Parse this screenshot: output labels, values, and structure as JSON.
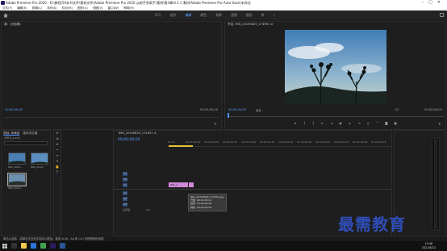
{
  "window": {
    "title": "Adobe Premiere Pro 2020 - D:\\教程\\50本书文件\\素材文件\\Adobe Premiere Pro 2020 从新手到高手\\素材\\第4章\\4.1.1 素材\\Adobe Premiere Pro Auto-Save\\未命名"
  },
  "menu": [
    "文件(F)",
    "编辑(E)",
    "剪辑(C)",
    "序列(S)",
    "标记(M)",
    "图形(G)",
    "视图(V)",
    "窗口(W)",
    "帮助(H)"
  ],
  "workspace_tabs": [
    "学习",
    "组件",
    "编辑",
    "颜色",
    "效果",
    "音频",
    "图形",
    "库",
    "»"
  ],
  "workspace_active": 2,
  "source": {
    "title": "源：(无剪辑)",
    "timecode": "00;00;00;00",
    "timecode_right": "00;00;00;00"
  },
  "program": {
    "title": "节目: IMG_20190829_174951 ≡",
    "timecode": "00;00;00;00",
    "fit": "适合",
    "ratio": "1/2",
    "duration": "00;00;05;00"
  },
  "project": {
    "tabs": [
      "项目: 未命名",
      "媒体浏览器"
    ],
    "path": "未命名.prproj",
    "items": [
      {
        "label": "IMG_2019...",
        "dur": "5;00"
      },
      {
        "label": "IMG_2019...",
        "dur": "5;00"
      },
      {
        "label": "IMG_2019...",
        "dur": "5;00"
      }
    ]
  },
  "timeline": {
    "tab": "IMG_20190829_174951 ≡",
    "timecode": "00;00;00;00",
    "ruler": [
      "00;00",
      "00;00;04;29",
      "00;00;09;29",
      "00;00;14;29",
      "00;00;19;29",
      "00;00;24;29",
      "00;00;29;29",
      "00;00;34;28",
      "00;00;39;28",
      "00;00;44;28",
      "00;00;49;28",
      "00;00;54;28"
    ],
    "tracks": [
      "V3",
      "V2",
      "V1",
      "A1",
      "A2",
      "A3",
      "主声道"
    ],
    "master_value": "0.0",
    "clip_label": "IMG_2",
    "tooltip": [
      "IMG_20190829_174951.jpg",
      "开始: 00;00;05;21",
      "结束: 00;00;04;29",
      "持续: 00;00;05;00"
    ]
  },
  "status": "单击以选择，或单击空白处并拖动以框选。使用 Shift、Alt 和 Ctrl 可获得其他选项。",
  "taskbar": {
    "time": "15:46",
    "date": "2021/8/22"
  },
  "watermark": "最需教育",
  "colors": {
    "accent": "#4a8eff",
    "clip": "#d08ad9",
    "playhead": "#e3c33a",
    "watermark": "#2f4db6"
  }
}
